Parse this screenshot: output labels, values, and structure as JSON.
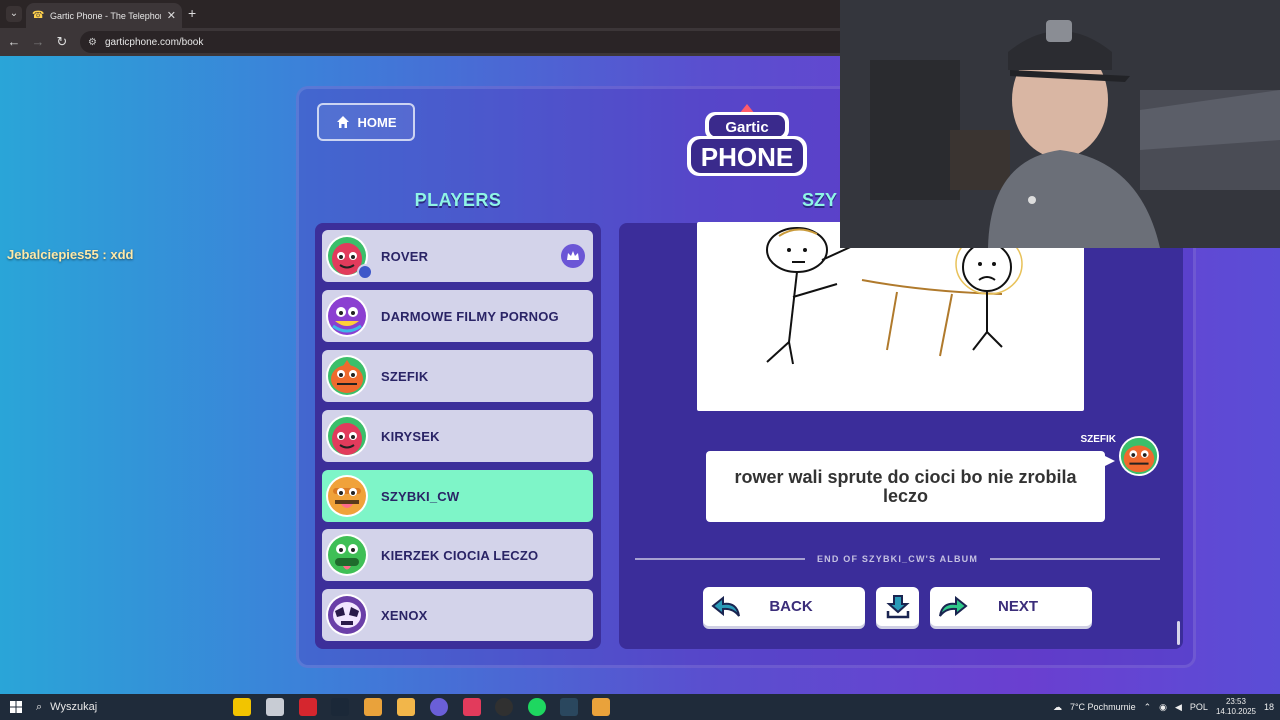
{
  "browser": {
    "tab_title": "Gartic Phone - The Telephone G",
    "url": "garticphone.com/book"
  },
  "chat": {
    "message": "Jebalciepies55 : xdd"
  },
  "header": {
    "home_label": "HOME",
    "logo_top": "Gartic",
    "logo_bottom": "PHONE"
  },
  "players": {
    "title": "PLAYERS",
    "items": [
      {
        "name": "ROVER",
        "host": true,
        "active": false,
        "avatar_color": "#e23b5c"
      },
      {
        "name": "DARMOWE FILMY PORNOG",
        "host": false,
        "active": false,
        "avatar_color": "#8b3fd1"
      },
      {
        "name": "SZEFIK",
        "host": false,
        "active": false,
        "avatar_color": "#ef6a2e"
      },
      {
        "name": "KIRYSEK",
        "host": false,
        "active": false,
        "avatar_color": "#e23b5c"
      },
      {
        "name": "SZYBKI_CW",
        "host": false,
        "active": true,
        "avatar_color": "#f0a23a"
      },
      {
        "name": "KIERZEK CIOCIA LECZO",
        "host": false,
        "active": false,
        "avatar_color": "#3fbf56"
      },
      {
        "name": "XENOX",
        "host": false,
        "active": false,
        "avatar_color": "#6a3fa8"
      }
    ]
  },
  "album": {
    "title_partial": "SZY",
    "author": "SZEFIK",
    "caption": "rower wali sprute do cioci bo nie zrobila leczo",
    "end_text": "END OF SZYBKI_CW'S ALBUM",
    "back_label": "BACK",
    "next_label": "NEXT"
  },
  "taskbar": {
    "search_placeholder": "Wyszukaj",
    "weather": "7°C Pochmurnie",
    "lang": "POL",
    "time": "23:53",
    "date": "14.10.2025",
    "notif_count": "18"
  }
}
